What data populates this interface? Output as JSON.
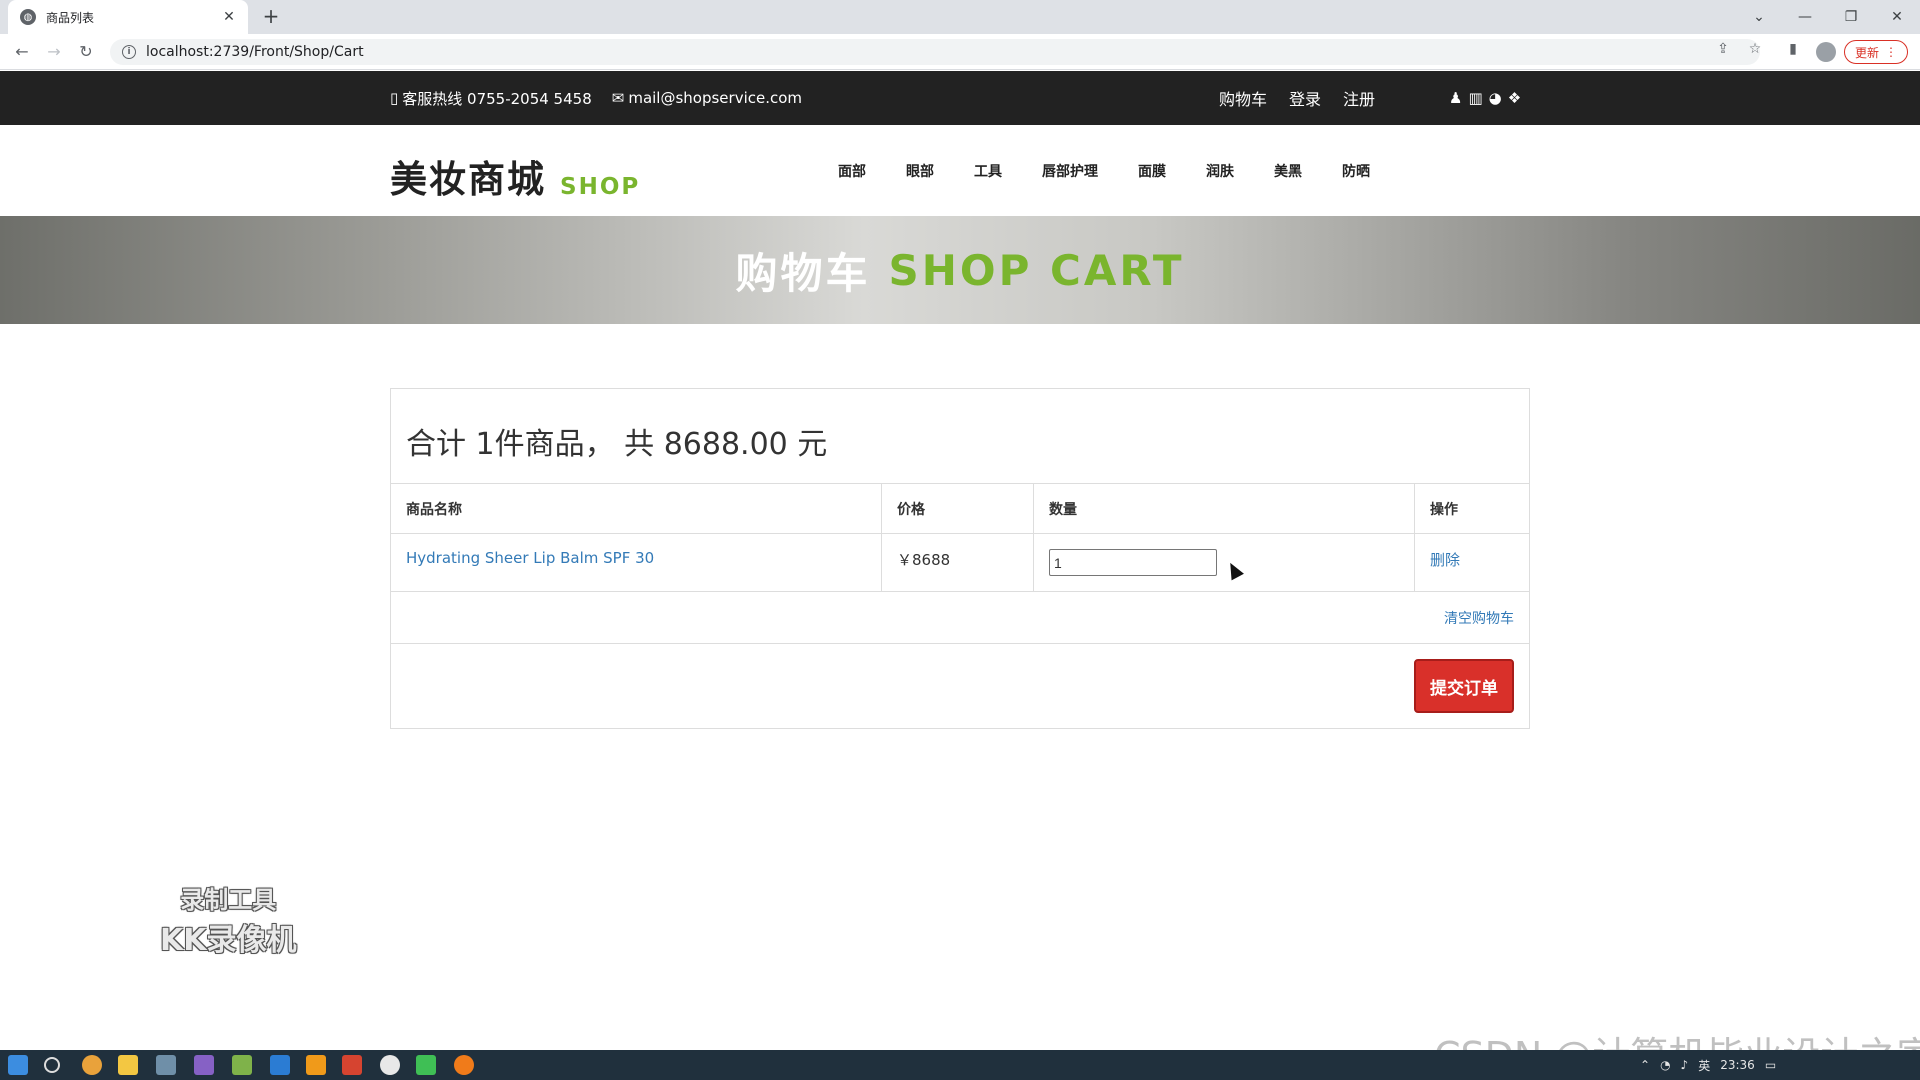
{
  "browser": {
    "tab_title": "商品列表",
    "url": "localhost:2739/Front/Shop/Cart",
    "update_label": "更新"
  },
  "topbar": {
    "phone": "客服热线 0755-2054 5458",
    "email": "mail@shopservice.com",
    "links": [
      "购物车",
      "登录",
      "注册"
    ]
  },
  "header": {
    "logo_cn": "美妆商城",
    "logo_en": "SHOP",
    "nav": [
      "面部",
      "眼部",
      "工具",
      "唇部护理",
      "面膜",
      "润肤",
      "美黑",
      "防晒"
    ]
  },
  "banner": {
    "title_cn": "购物车",
    "title_en": "SHOP CART"
  },
  "cart": {
    "summary": "合计 1件商品， 共 8688.00 元",
    "columns": [
      "商品名称",
      "价格",
      "数量",
      "操作"
    ],
    "items": [
      {
        "name": "Hydrating Sheer Lip Balm SPF 30",
        "price": "￥8688",
        "quantity": "1",
        "action": "删除"
      }
    ],
    "clear_label": "清空购物车",
    "submit_label": "提交订单"
  },
  "watermarks": {
    "kk_line1": "录制工具",
    "kk_line2": "KK录像机",
    "csdn": "CSDN @计算机毕业设计之家"
  },
  "taskbar": {
    "language": "英",
    "time": "23:36"
  },
  "colors": {
    "accent_green": "#7ab52e",
    "submit_red": "#d9302a",
    "link_blue": "#337ab7",
    "topbar_bg": "#222222"
  }
}
